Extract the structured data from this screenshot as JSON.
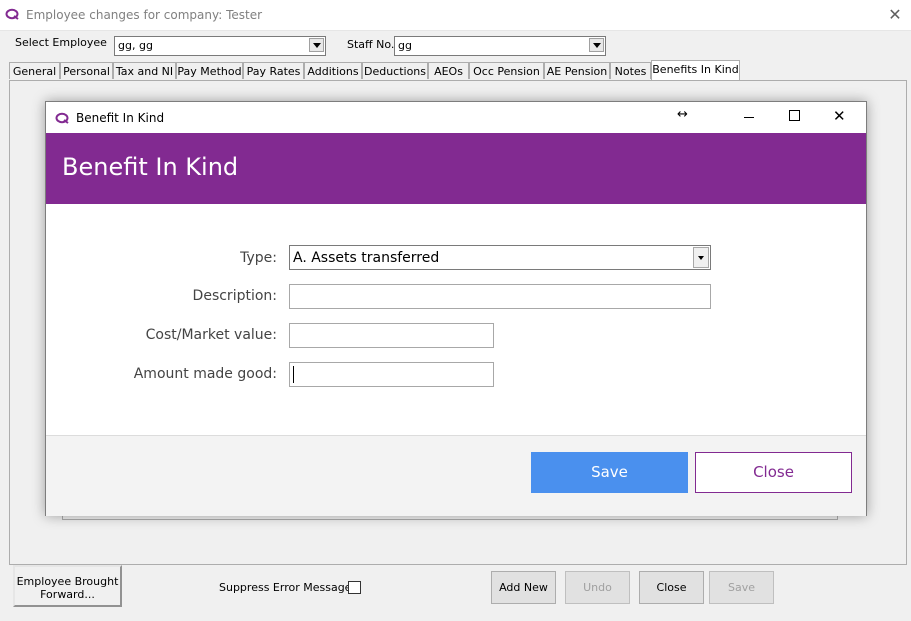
{
  "outer": {
    "title": "Employee changes for company: Tester",
    "select_employee_label": "Select Employee",
    "select_employee_value": "gg, gg",
    "staff_no_label": "Staff No.",
    "staff_no_value": "gg",
    "tabs": [
      "General",
      "Personal",
      "Tax and NI",
      "Pay Method",
      "Pay Rates",
      "Additions",
      "Deductions",
      "AEOs",
      "Occ Pension",
      "AE Pension",
      "Notes",
      "Benefits In Kind"
    ],
    "active_tab": "Benefits In Kind",
    "bottom": {
      "brought_forward": "Employee Brought Forward...",
      "suppress_label": "Suppress Error Message",
      "add_new": "Add New",
      "undo": "Undo",
      "close": "Close",
      "save": "Save"
    }
  },
  "dialog": {
    "window_title": "Benefit In Kind",
    "header_title": "Benefit In Kind",
    "fields": {
      "type_label": "Type:",
      "type_value": "A. Assets transferred",
      "description_label": "Description:",
      "description_value": "",
      "cost_label": "Cost/Market value:",
      "cost_value": "",
      "amount_label": "Amount made good:",
      "amount_value": ""
    },
    "save_label": "Save",
    "close_label": "Close"
  },
  "colors": {
    "brand_purple": "#822a91",
    "save_blue": "#4a90ee"
  },
  "icons": [
    "app-logo-icon",
    "close-icon",
    "resize-icon",
    "minimize-icon",
    "maximize-icon",
    "dropdown-arrow-icon",
    "checkbox-icon"
  ]
}
